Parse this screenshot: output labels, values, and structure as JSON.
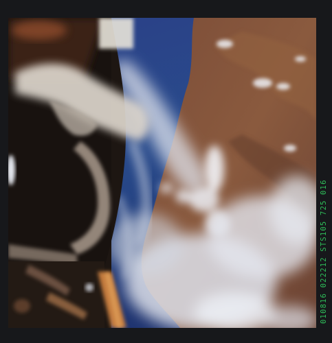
{
  "photo": {
    "subject": "earth-observation-from-orbit",
    "film_code": "010816 022212 STS105 725 016"
  },
  "colors": {
    "border": "#17181b",
    "ocean": "#24407e",
    "land": "#7a4a33",
    "cloud": "#e6e8ee",
    "code_text": "#2fbf5a"
  }
}
